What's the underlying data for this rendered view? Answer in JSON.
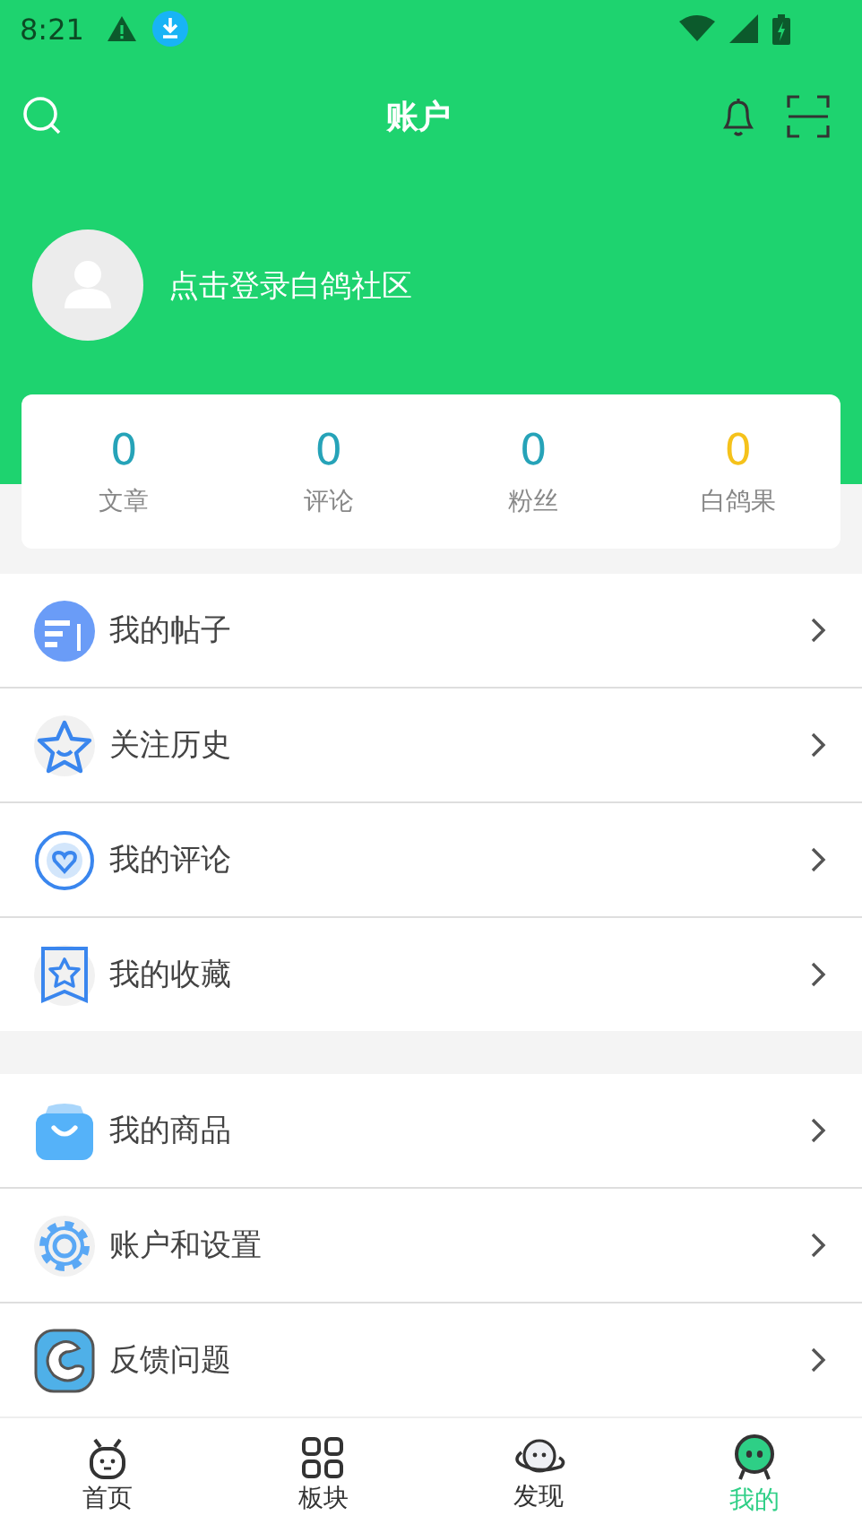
{
  "status_bar": {
    "time": "8:21"
  },
  "app_bar": {
    "title": "账户"
  },
  "profile": {
    "login_prompt": "点击登录白鸽社区"
  },
  "stats": [
    {
      "value": "0",
      "label": "文章",
      "color": "#26a3b8"
    },
    {
      "value": "0",
      "label": "评论",
      "color": "#26a3b8"
    },
    {
      "value": "0",
      "label": "粉丝",
      "color": "#26a3b8"
    },
    {
      "value": "0",
      "label": "白鸽果",
      "color": "#f5c21b"
    }
  ],
  "menu_groups": [
    [
      {
        "kind": "posts",
        "label": "我的帖子"
      },
      {
        "kind": "follow",
        "label": "关注历史"
      },
      {
        "kind": "comments",
        "label": "我的评论"
      },
      {
        "kind": "favorites",
        "label": "我的收藏"
      }
    ],
    [
      {
        "kind": "goods",
        "label": "我的商品"
      },
      {
        "kind": "settings",
        "label": "账户和设置"
      },
      {
        "kind": "feedback",
        "label": "反馈问题"
      }
    ]
  ],
  "tab_bar": [
    {
      "kind": "home",
      "label": "首页",
      "selected": false
    },
    {
      "kind": "boards",
      "label": "板块",
      "selected": false
    },
    {
      "kind": "discover",
      "label": "发现",
      "selected": false
    },
    {
      "kind": "me",
      "label": "我的",
      "selected": true
    }
  ]
}
